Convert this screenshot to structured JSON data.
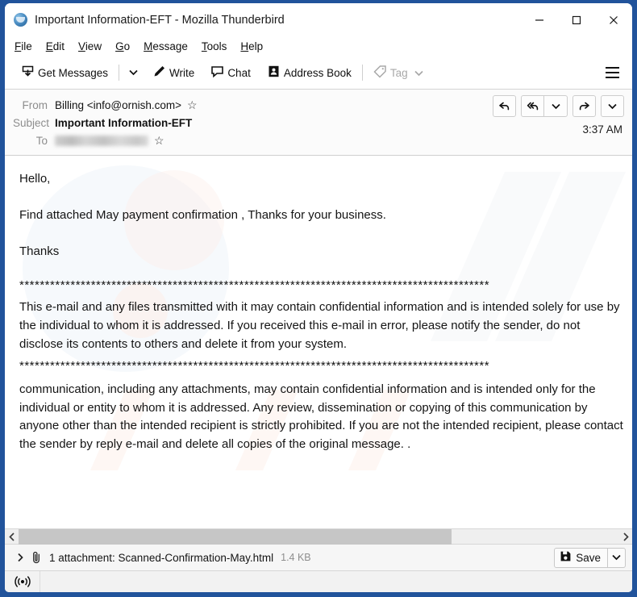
{
  "window": {
    "title": "Important Information-EFT - Mozilla Thunderbird",
    "app_icon": "thunderbird-icon",
    "controls": {
      "minimize": "minimize-icon",
      "maximize": "maximize-icon",
      "close": "close-icon"
    }
  },
  "menubar": {
    "items": [
      {
        "label": "File",
        "access_key": "F"
      },
      {
        "label": "Edit",
        "access_key": "E"
      },
      {
        "label": "View",
        "access_key": "V"
      },
      {
        "label": "Go",
        "access_key": "G"
      },
      {
        "label": "Message",
        "access_key": "M"
      },
      {
        "label": "Tools",
        "access_key": "T"
      },
      {
        "label": "Help",
        "access_key": "H"
      }
    ]
  },
  "toolbar": {
    "get_messages_label": "Get Messages",
    "write_label": "Write",
    "chat_label": "Chat",
    "address_book_label": "Address Book",
    "tag_label": "Tag",
    "tag_disabled": true,
    "app_menu": "hamburger-icon"
  },
  "message_header": {
    "from_label": "From",
    "from_value": "Billing <info@ornish.com>",
    "subject_label": "Subject",
    "subject_value": "Important Information-EFT",
    "to_label": "To",
    "to_value": "",
    "to_redacted": true,
    "time": "3:37 AM",
    "actions": {
      "reply": "reply-icon",
      "reply_all": "reply-all-icon",
      "reply_more": "chevron-down-icon",
      "forward": "forward-icon",
      "more": "chevron-down-icon"
    }
  },
  "message_body": {
    "greeting": "Hello,",
    "line_1": "Find attached May payment confirmation , Thanks for your business.",
    "signoff": "Thanks",
    "separator": "********************************************************************************************",
    "disclaimer_1": "This e-mail and any files transmitted with it may contain confidential information and is intended solely for use by the individual to whom it is addressed. If you received this e-mail in error, please notify the sender, do not disclose its contents to others and delete it from your system.",
    "disclaimer_2": "communication, including any attachments, may contain confidential information and is intended only for the individual or entity to whom it is addressed. Any review, dissemination or copying of this communication by anyone other than the intended recipient is strictly prohibited. If you are not the intended recipient, please contact the sender by reply e-mail and delete all copies of the original message. ."
  },
  "scrollbar": {
    "left_arrow": "chevron-left-icon",
    "right_arrow": "chevron-right-icon"
  },
  "attachment_bar": {
    "expand_icon": "chevron-right-icon",
    "clip_icon": "paperclip-icon",
    "text": "1 attachment: Scanned-Confirmation-May.html",
    "size": "1.4 KB",
    "save_label": "Save",
    "save_icon": "save-icon",
    "save_caret": "chevron-down-icon"
  },
  "statusbar": {
    "icon": "broadcast-icon"
  },
  "colors": {
    "window_frame": "#21539b",
    "header_bg": "#fbfbfb",
    "scrollbar_thumb": "#c6c6c6",
    "muted_text": "#8d8d8d"
  }
}
